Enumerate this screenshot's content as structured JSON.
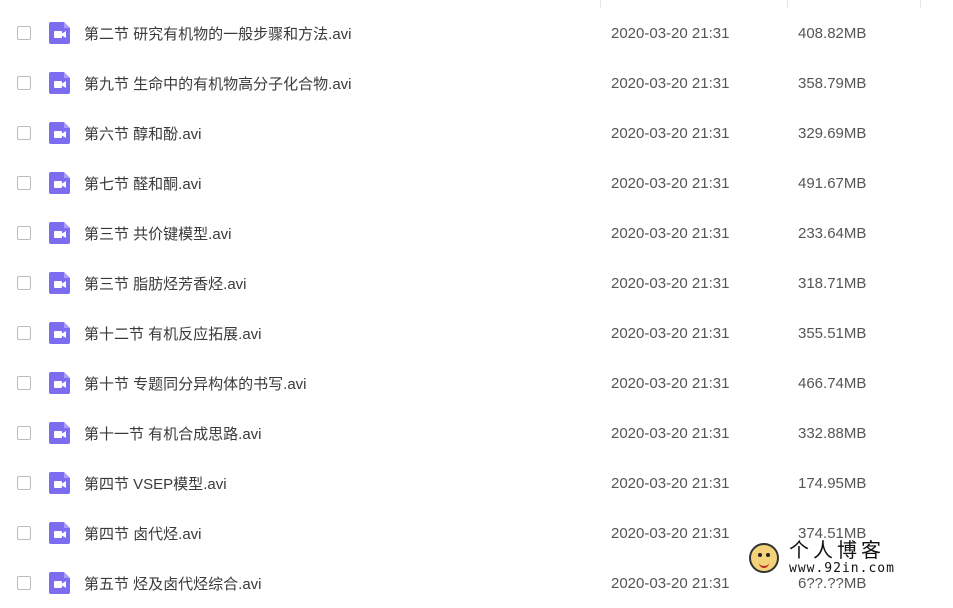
{
  "files": [
    {
      "name": "第二节 研究有机物的一般步骤和方法.avi",
      "date": "2020-03-20 21:31",
      "size": "408.82MB"
    },
    {
      "name": "第九节 生命中的有机物高分子化合物.avi",
      "date": "2020-03-20 21:31",
      "size": "358.79MB"
    },
    {
      "name": "第六节 醇和酚.avi",
      "date": "2020-03-20 21:31",
      "size": "329.69MB"
    },
    {
      "name": "第七节 醛和酮.avi",
      "date": "2020-03-20 21:31",
      "size": "491.67MB"
    },
    {
      "name": "第三节 共价键模型.avi",
      "date": "2020-03-20 21:31",
      "size": "233.64MB"
    },
    {
      "name": "第三节 脂肪烃芳香烃.avi",
      "date": "2020-03-20 21:31",
      "size": "318.71MB"
    },
    {
      "name": "第十二节 有机反应拓展.avi",
      "date": "2020-03-20 21:31",
      "size": "355.51MB"
    },
    {
      "name": "第十节 专题同分异构体的书写.avi",
      "date": "2020-03-20 21:31",
      "size": "466.74MB"
    },
    {
      "name": "第十一节 有机合成思路.avi",
      "date": "2020-03-20 21:31",
      "size": "332.88MB"
    },
    {
      "name": "第四节 VSEP模型.avi",
      "date": "2020-03-20 21:31",
      "size": "174.95MB"
    },
    {
      "name": "第四节 卤代烃.avi",
      "date": "2020-03-20 21:31",
      "size": "374.51MB"
    },
    {
      "name": "第五节 烃及卤代烃综合.avi",
      "date": "2020-03-20 21:31",
      "size": "6??.??MB"
    }
  ],
  "icon": {
    "name": "video-file-icon",
    "color": "#7c6cf0"
  },
  "watermark": {
    "title": "个人博客",
    "url": "www.92in.com"
  }
}
